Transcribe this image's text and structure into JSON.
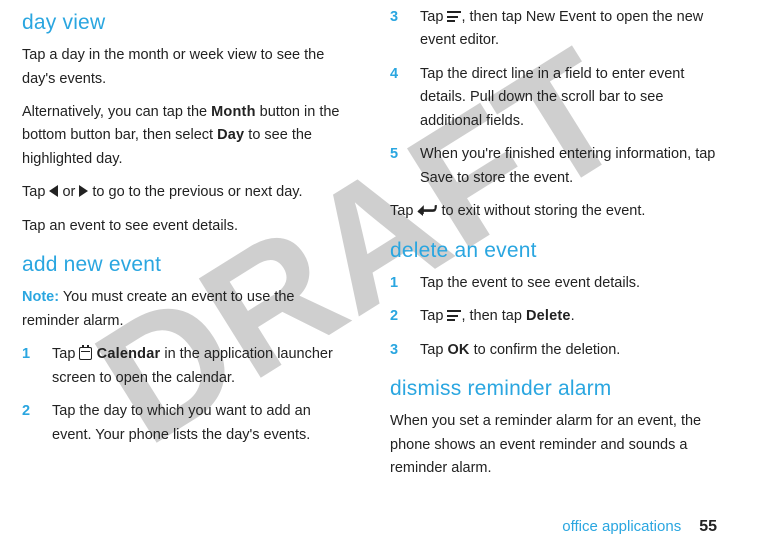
{
  "watermark": "DRAFT",
  "col1": {
    "h_dayview": "day view",
    "p1": "Tap a day in the month or week view to see the day's events.",
    "p2a": "Alternatively, you can tap the ",
    "p2_month": "Month",
    "p2b": " button in the bottom button bar, then select ",
    "p2_day": "Day",
    "p2c": " to see the highlighted day.",
    "p3a": "Tap ",
    "p3b": " or ",
    "p3c": " to go to the previous or next day.",
    "p4": "Tap an event to see event details.",
    "h_add": "add new event",
    "note_label": "Note:",
    "note_text": " You must create an event to use the reminder alarm.",
    "s1a": "Tap ",
    "s1_cal": " Calendar",
    "s1b": " in the application launcher screen to open the calendar.",
    "s2": "Tap the day to which you want to add an event. Your phone lists the day's events."
  },
  "col2": {
    "s3a": "Tap ",
    "s3b": ", then tap New Event to open the new event editor.",
    "s4": "Tap the direct line in a field to enter event details. Pull down the scroll bar to see additional fields.",
    "s5": "When you're finished entering information, tap Save to store the event.",
    "exit_a": "Tap ",
    "exit_b": " to exit without storing the event.",
    "h_delete": "delete an event",
    "d1": "Tap the event to see event details.",
    "d2a": "Tap ",
    "d2b": ", then tap ",
    "d2_delete": "Delete",
    "d2c": ".",
    "d3a": "Tap ",
    "d3_ok": "OK",
    "d3b": " to confirm the deletion.",
    "h_dismiss": "dismiss reminder alarm",
    "dismiss_p": "When you set a reminder alarm for an event, the phone shows an event reminder and sounds a reminder alarm."
  },
  "nums": {
    "n1": "1",
    "n2": "2",
    "n3": "3",
    "n4": "4",
    "n5": "5"
  },
  "footer": {
    "label": "office applications",
    "page": "55"
  }
}
